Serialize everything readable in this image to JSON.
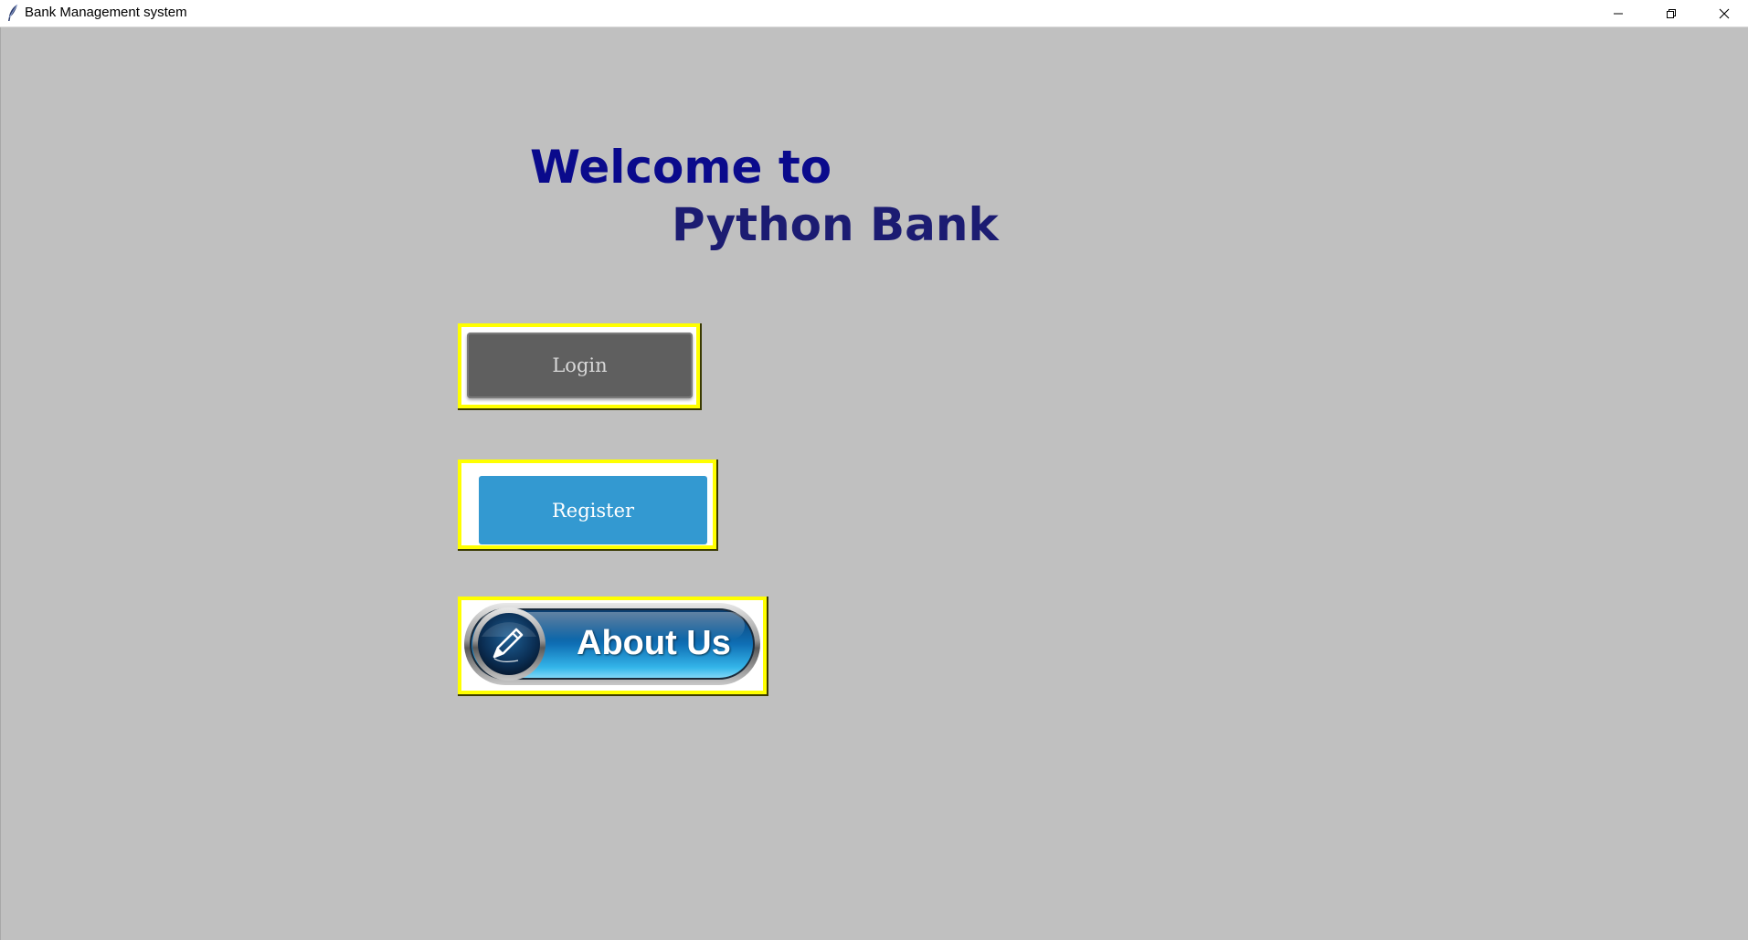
{
  "window": {
    "title": "Bank Management system",
    "icons": {
      "app": "feather-icon",
      "minimize": "minimize-icon",
      "maximize": "restore-icon",
      "close": "close-icon"
    }
  },
  "welcome": {
    "line1": "Welcome to",
    "line2": "Python Bank"
  },
  "buttons": {
    "login": "Login",
    "register": "Register",
    "about": "About Us"
  },
  "colors": {
    "background": "#c0c0c0",
    "heading": "#0a0a8c",
    "frame": "#ffff00",
    "login_face": "#5f5f5f",
    "register_face": "#3399d1",
    "about_face": "#1a7fc0"
  }
}
